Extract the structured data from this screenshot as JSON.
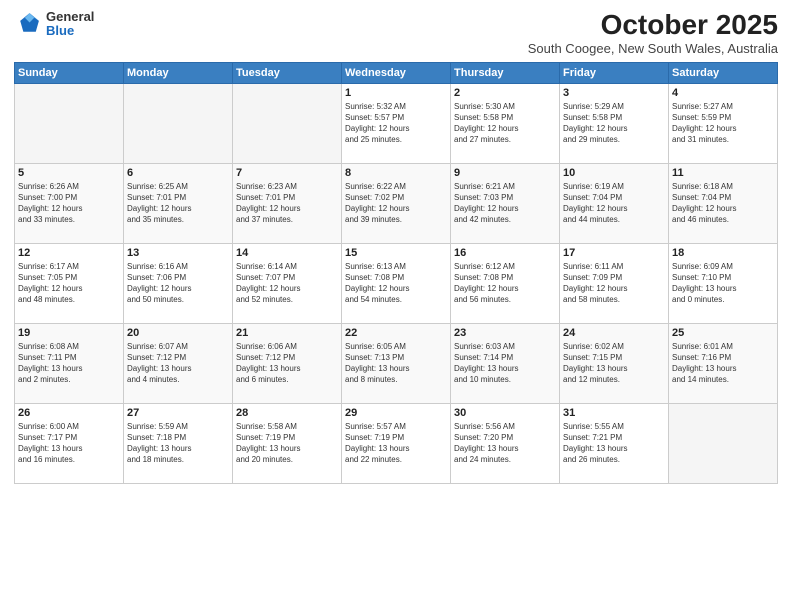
{
  "header": {
    "logo_general": "General",
    "logo_blue": "Blue",
    "month_title": "October 2025",
    "subtitle": "South Coogee, New South Wales, Australia"
  },
  "days_of_week": [
    "Sunday",
    "Monday",
    "Tuesday",
    "Wednesday",
    "Thursday",
    "Friday",
    "Saturday"
  ],
  "weeks": [
    [
      {
        "day": "",
        "info": ""
      },
      {
        "day": "",
        "info": ""
      },
      {
        "day": "",
        "info": ""
      },
      {
        "day": "1",
        "info": "Sunrise: 5:32 AM\nSunset: 5:57 PM\nDaylight: 12 hours\nand 25 minutes."
      },
      {
        "day": "2",
        "info": "Sunrise: 5:30 AM\nSunset: 5:58 PM\nDaylight: 12 hours\nand 27 minutes."
      },
      {
        "day": "3",
        "info": "Sunrise: 5:29 AM\nSunset: 5:58 PM\nDaylight: 12 hours\nand 29 minutes."
      },
      {
        "day": "4",
        "info": "Sunrise: 5:27 AM\nSunset: 5:59 PM\nDaylight: 12 hours\nand 31 minutes."
      }
    ],
    [
      {
        "day": "5",
        "info": "Sunrise: 6:26 AM\nSunset: 7:00 PM\nDaylight: 12 hours\nand 33 minutes."
      },
      {
        "day": "6",
        "info": "Sunrise: 6:25 AM\nSunset: 7:01 PM\nDaylight: 12 hours\nand 35 minutes."
      },
      {
        "day": "7",
        "info": "Sunrise: 6:23 AM\nSunset: 7:01 PM\nDaylight: 12 hours\nand 37 minutes."
      },
      {
        "day": "8",
        "info": "Sunrise: 6:22 AM\nSunset: 7:02 PM\nDaylight: 12 hours\nand 39 minutes."
      },
      {
        "day": "9",
        "info": "Sunrise: 6:21 AM\nSunset: 7:03 PM\nDaylight: 12 hours\nand 42 minutes."
      },
      {
        "day": "10",
        "info": "Sunrise: 6:19 AM\nSunset: 7:04 PM\nDaylight: 12 hours\nand 44 minutes."
      },
      {
        "day": "11",
        "info": "Sunrise: 6:18 AM\nSunset: 7:04 PM\nDaylight: 12 hours\nand 46 minutes."
      }
    ],
    [
      {
        "day": "12",
        "info": "Sunrise: 6:17 AM\nSunset: 7:05 PM\nDaylight: 12 hours\nand 48 minutes."
      },
      {
        "day": "13",
        "info": "Sunrise: 6:16 AM\nSunset: 7:06 PM\nDaylight: 12 hours\nand 50 minutes."
      },
      {
        "day": "14",
        "info": "Sunrise: 6:14 AM\nSunset: 7:07 PM\nDaylight: 12 hours\nand 52 minutes."
      },
      {
        "day": "15",
        "info": "Sunrise: 6:13 AM\nSunset: 7:08 PM\nDaylight: 12 hours\nand 54 minutes."
      },
      {
        "day": "16",
        "info": "Sunrise: 6:12 AM\nSunset: 7:08 PM\nDaylight: 12 hours\nand 56 minutes."
      },
      {
        "day": "17",
        "info": "Sunrise: 6:11 AM\nSunset: 7:09 PM\nDaylight: 12 hours\nand 58 minutes."
      },
      {
        "day": "18",
        "info": "Sunrise: 6:09 AM\nSunset: 7:10 PM\nDaylight: 13 hours\nand 0 minutes."
      }
    ],
    [
      {
        "day": "19",
        "info": "Sunrise: 6:08 AM\nSunset: 7:11 PM\nDaylight: 13 hours\nand 2 minutes."
      },
      {
        "day": "20",
        "info": "Sunrise: 6:07 AM\nSunset: 7:12 PM\nDaylight: 13 hours\nand 4 minutes."
      },
      {
        "day": "21",
        "info": "Sunrise: 6:06 AM\nSunset: 7:12 PM\nDaylight: 13 hours\nand 6 minutes."
      },
      {
        "day": "22",
        "info": "Sunrise: 6:05 AM\nSunset: 7:13 PM\nDaylight: 13 hours\nand 8 minutes."
      },
      {
        "day": "23",
        "info": "Sunrise: 6:03 AM\nSunset: 7:14 PM\nDaylight: 13 hours\nand 10 minutes."
      },
      {
        "day": "24",
        "info": "Sunrise: 6:02 AM\nSunset: 7:15 PM\nDaylight: 13 hours\nand 12 minutes."
      },
      {
        "day": "25",
        "info": "Sunrise: 6:01 AM\nSunset: 7:16 PM\nDaylight: 13 hours\nand 14 minutes."
      }
    ],
    [
      {
        "day": "26",
        "info": "Sunrise: 6:00 AM\nSunset: 7:17 PM\nDaylight: 13 hours\nand 16 minutes."
      },
      {
        "day": "27",
        "info": "Sunrise: 5:59 AM\nSunset: 7:18 PM\nDaylight: 13 hours\nand 18 minutes."
      },
      {
        "day": "28",
        "info": "Sunrise: 5:58 AM\nSunset: 7:19 PM\nDaylight: 13 hours\nand 20 minutes."
      },
      {
        "day": "29",
        "info": "Sunrise: 5:57 AM\nSunset: 7:19 PM\nDaylight: 13 hours\nand 22 minutes."
      },
      {
        "day": "30",
        "info": "Sunrise: 5:56 AM\nSunset: 7:20 PM\nDaylight: 13 hours\nand 24 minutes."
      },
      {
        "day": "31",
        "info": "Sunrise: 5:55 AM\nSunset: 7:21 PM\nDaylight: 13 hours\nand 26 minutes."
      },
      {
        "day": "",
        "info": ""
      }
    ]
  ]
}
